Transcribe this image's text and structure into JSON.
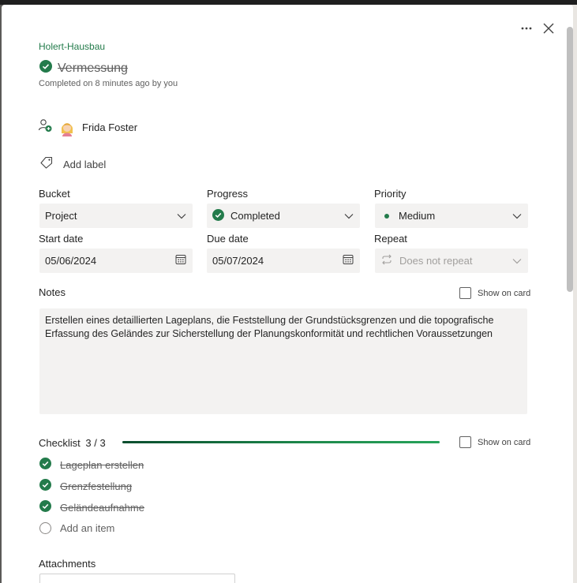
{
  "task": {
    "plan_name": "Holert-Hausbau",
    "title": "Vermessung",
    "completed_text": "Completed on 8 minutes ago by you",
    "assignee": "Frida Foster",
    "add_label": "Add label"
  },
  "fields": {
    "bucket": {
      "label": "Bucket",
      "value": "Project"
    },
    "progress": {
      "label": "Progress",
      "value": "Completed"
    },
    "priority": {
      "label": "Priority",
      "value": "Medium"
    },
    "start_date": {
      "label": "Start date",
      "value": "05/06/2024"
    },
    "due_date": {
      "label": "Due date",
      "value": "05/07/2024"
    },
    "repeat": {
      "label": "Repeat",
      "value": "Does not repeat"
    }
  },
  "notes": {
    "label": "Notes",
    "show_on_card": "Show on card",
    "text": "Erstellen eines detaillierten Lageplans, die Feststellung der Grundstücksgrenzen und die topografische Erfassung des Geländes zur Sicherstellung der Planungskonformität und rechtlichen Voraussetzungen"
  },
  "checklist": {
    "label": "Checklist",
    "count": "3 / 3",
    "progress": 1.0,
    "show_on_card": "Show on card",
    "items": [
      {
        "text": "Lageplan erstellen",
        "done": true
      },
      {
        "text": "Grenzfestellung",
        "done": true
      },
      {
        "text": "Geländeaufnahme",
        "done": true
      }
    ],
    "add_item": "Add an item"
  },
  "attachments": {
    "label": "Attachments"
  },
  "icons": {
    "more": "more-icon",
    "close": "close-icon",
    "complete": "check-circle-icon",
    "assign": "person-add-icon",
    "label": "tag-icon",
    "calendar": "calendar-icon",
    "repeat": "repeat-icon",
    "chevron": "chevron-down-icon"
  },
  "colors": {
    "accent": "#237b4b",
    "complete_check": "#237b4b"
  }
}
